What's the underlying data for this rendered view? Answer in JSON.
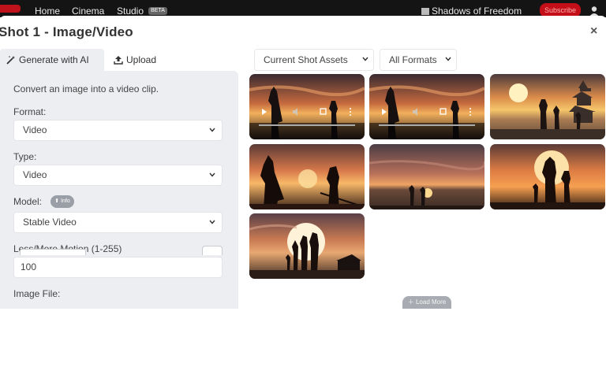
{
  "nav": {
    "links": [
      "Home",
      "Cinema",
      "Studio"
    ],
    "beta_badge": "BETA",
    "project_title": "Shadows of Freedom",
    "red_button": "Subscribe"
  },
  "modal": {
    "title": "Shot 1 - Image/Video",
    "close": "×"
  },
  "tabs": {
    "generate": "Generate with AI",
    "upload": "Upload"
  },
  "form": {
    "description": "Convert an image into a video clip.",
    "format_label": "Format:",
    "format_value": "Video",
    "type_label": "Type:",
    "type_value": "Video",
    "model_label": "Model:",
    "model_info": "Info",
    "model_value": "Stable Video",
    "motion_label": "Less/More Motion (1-255)",
    "motion_value": "100",
    "image_label": "Image File:"
  },
  "filters": {
    "assets": "Current Shot Assets",
    "formats": "All Formats"
  },
  "assets": [
    {
      "kind": "video",
      "description": "two silhouettes at sunset"
    },
    {
      "kind": "video",
      "description": "two silhouettes at sunset"
    },
    {
      "kind": "image",
      "description": "figures and pagoda at sunset"
    },
    {
      "kind": "image",
      "description": "cloaked warriors with swords"
    },
    {
      "kind": "image",
      "description": "two small figures on horizon"
    },
    {
      "kind": "image",
      "description": "group before large sun"
    },
    {
      "kind": "image",
      "description": "group before moon with temple"
    }
  ],
  "load_more": "Load More",
  "colors": {
    "panel_bg": "#eceef2",
    "nav_bg": "#141414",
    "brand_red": "#c40f18"
  }
}
